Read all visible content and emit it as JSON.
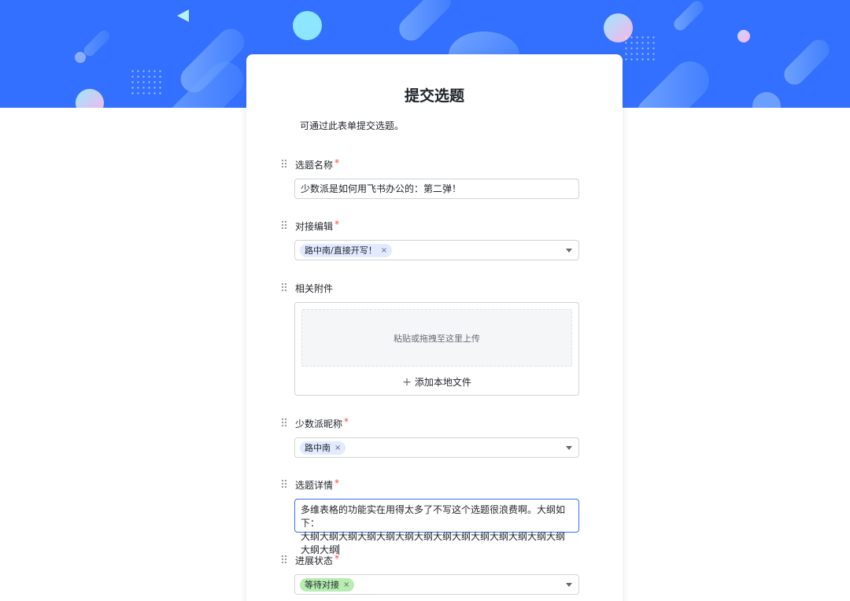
{
  "form": {
    "title": "提交选题",
    "description": "可通过此表单提交选题。"
  },
  "fields": {
    "topic_name": {
      "label": "选题名称",
      "required_mark": "*",
      "value": "少数派是如何用飞书办公的：第二弹！"
    },
    "editor": {
      "label": "对接编辑",
      "required_mark": "*",
      "tag": "路中南/直接开写！",
      "tag_remove": "×",
      "tag_color": "#e1eaff"
    },
    "attachments": {
      "label": "相关附件",
      "dropzone_text": "粘贴或拖拽至这里上传",
      "add_icon": "+",
      "add_label": "添加本地文件"
    },
    "nickname": {
      "label": "少数派昵称",
      "required_mark": "*",
      "tag": "路中南",
      "tag_remove": "×",
      "tag_color": "#e1eaff"
    },
    "details": {
      "label": "选题详情",
      "required_mark": "*",
      "line1": "多维表格的功能实在用得太多了不写这个选题很浪费啊。大纲如下：",
      "line2": "大纲大纲大纲大纲大纲大纲大纲大纲大纲大纲大纲大纲大纲大纲大纲大纲"
    },
    "status": {
      "label": "进展状态",
      "required_mark": "*",
      "tag": "等待对接",
      "tag_remove": "×",
      "tag_color": "#b7edb1"
    }
  },
  "colors": {
    "banner": "#3370ff",
    "accent": "#3370ff",
    "required": "#f54a45"
  }
}
